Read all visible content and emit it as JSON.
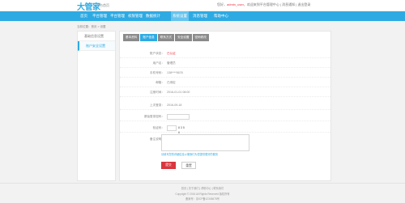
{
  "header": {
    "logo": "大管家",
    "logo_sub": "平台首页",
    "top_links_prefix": "您好，",
    "top_links_user": "admin_user",
    "top_links_rest": "，欢迎来到平台管理中心 | 消息通知 | 退出登录",
    "nav": [
      {
        "label": "首页",
        "active": false
      },
      {
        "label": "平台管理",
        "active": false
      },
      {
        "label": "平台管理",
        "active": false
      },
      {
        "label": "权限管理",
        "active": false
      },
      {
        "label": "数据统计",
        "active": false
      },
      {
        "label": "系统设置",
        "active": true
      },
      {
        "label": "消息管理",
        "active": false
      },
      {
        "label": "帮助中心",
        "active": false
      }
    ]
  },
  "breadcrumb": "当前位置：首页 > 设置",
  "sidebar": {
    "items": [
      {
        "label": "基础信息设置",
        "active": false
      },
      {
        "label": "账户安全设置",
        "active": true
      }
    ]
  },
  "tabs": [
    {
      "label": "基本资料",
      "active": false
    },
    {
      "label": "账户信息",
      "active": true
    },
    {
      "label": "联系方式",
      "active": false
    },
    {
      "label": "安全设置",
      "active": false
    },
    {
      "label": "密码修改",
      "active": false
    }
  ],
  "form": {
    "rows": [
      {
        "label": "账户状态：",
        "value": "已认证",
        "red": true
      },
      {
        "label": "用户名：",
        "value": "管理员",
        "red": false
      },
      {
        "label": "手机号码：",
        "value": "138****5678",
        "red": false
      },
      {
        "label": "邮箱：",
        "value": "已绑定",
        "red": false
      },
      {
        "label": "注册时间：",
        "value": "2016-01-01 08:00",
        "red": false
      },
      {
        "label": "上次登录：",
        "value": "2016-09-18",
        "red": false
      }
    ],
    "input_label_1": "原始登录密码：",
    "input_label_2": "验证码：",
    "captcha_text": "8 3 5 6",
    "textarea_label": "备注说明：",
    "notice": "请填写您的详细信息以便我们为您提供更好的服务"
  },
  "buttons": {
    "submit": "提交",
    "reset": "重置"
  },
  "footer": {
    "links": "首页 | 关于我们 | 帮助中心 | 联系我们",
    "copyright": "Copyright © 2016 All Rights Reserved 版权所有",
    "icp": "备案号：京ICP备12345678号"
  }
}
